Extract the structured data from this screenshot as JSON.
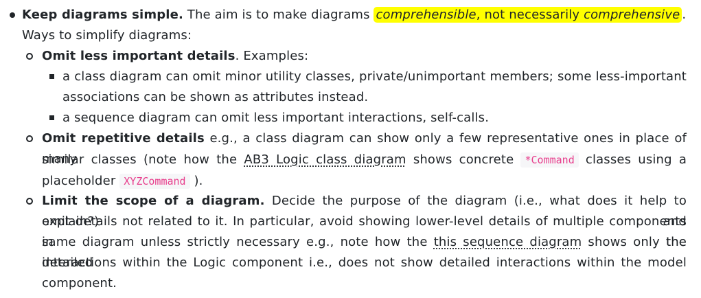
{
  "top_fragment": "                      ,              ",
  "item1": {
    "bold": "Keep diagrams simple.",
    "text_a": " The aim is to make diagrams ",
    "hl_a": "comprehensible",
    "hl_mid": ", not necessarily ",
    "hl_b": "comprehensive",
    "end": "."
  },
  "ways": "Ways to simplify diagrams:",
  "sub1": {
    "bold": "Omit less important details",
    "text": ". Examples:"
  },
  "ex1_line1": "a class diagram can omit minor utility classes, private/unimportant members; some less-important",
  "ex1_line2": "associations can be shown as attributes instead.",
  "ex2": "a sequence diagram can omit less important interactions, self-calls.",
  "sub2": {
    "bold": "Omit repetitive details",
    "line1_text": " e.g., a class diagram can show only a few representative ones in place of many",
    "line2_a": "similar classes (note how the ",
    "link": "AB3 Logic class diagram",
    "line2_b": " shows concrete ",
    "code1": "*Command",
    "line2_c": " classes using a",
    "line3_a": "placeholder ",
    "code2": "XYZCommand",
    "line3_b": " )."
  },
  "sub3": {
    "bold": "Limit the scope of a diagram.",
    "line1_text": " Decide the purpose of the diagram (i.e., what does it help to explain?) and",
    "line2": "omit details not related to it. In particular, avoid showing lower-level details of multiple components in the",
    "line3_a": "same diagram unless strictly necessary e.g., note how the ",
    "link": "this sequence diagram",
    "line3_b": " shows only the detailed",
    "line4": "interactions within the Logic component i.e., does not show detailed interactions within the model",
    "line5": "component."
  }
}
